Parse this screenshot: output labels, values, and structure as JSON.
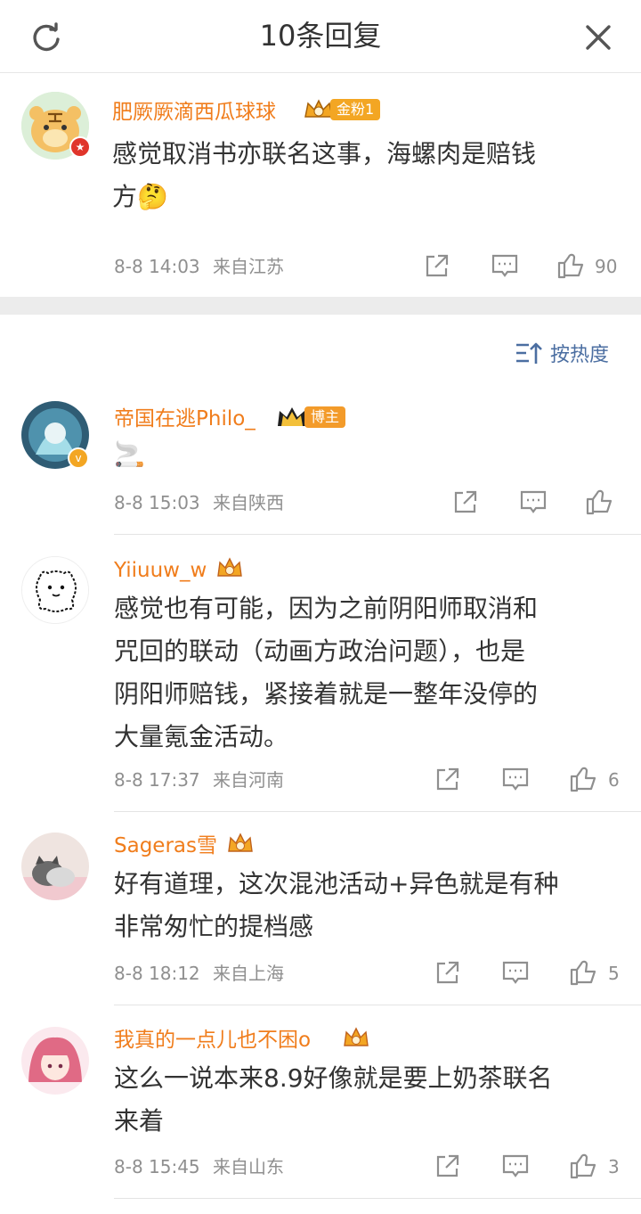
{
  "header": {
    "title": "10条回复",
    "refresh_icon": "refresh-icon",
    "close_icon": "close-icon"
  },
  "root_comment": {
    "author": "肥厥厥滴西瓜球球",
    "fan_badge": "金粉1",
    "text_line1": "感觉取消书亦联名这事，海螺肉是赔钱",
    "text_line2": "方",
    "emoji": "🤔",
    "date": "8-8 14:03",
    "location": "来自江苏",
    "likes": "90"
  },
  "sort": {
    "label": "按热度"
  },
  "replies": [
    {
      "author": "帝国在逃Philo_",
      "role_badge": "博主",
      "text": "🚬",
      "date": "8-8 15:03",
      "location": "来自陕西",
      "likes": ""
    },
    {
      "author": "Yiiuuw_w",
      "text_lines": [
        "感觉也有可能，因为之前阴阳师取消和",
        "咒回的联动（动画方政治问题），也是",
        "阴阳师赔钱，紧接着就是一整年没停的",
        "大量氪金活动。"
      ],
      "date": "8-8 17:37",
      "location": "来自河南",
      "likes": "6"
    },
    {
      "author": "Sageras雪",
      "text_lines": [
        "好有道理，这次混池活动+异色就是有种",
        "非常匆忙的提档感"
      ],
      "date": "8-8 18:12",
      "location": "来自上海",
      "likes": "5"
    },
    {
      "author": "我真的一点儿也不困o",
      "text_lines": [
        "这么一说本来8.9好像就是要上奶茶联名",
        "来着"
      ],
      "date": "8-8 15:45",
      "location": "来自山东",
      "likes": "3"
    }
  ],
  "colors": {
    "accent": "#f07d1c",
    "link_blue": "#4b6ea1",
    "badge_gold": "#f3a623"
  }
}
